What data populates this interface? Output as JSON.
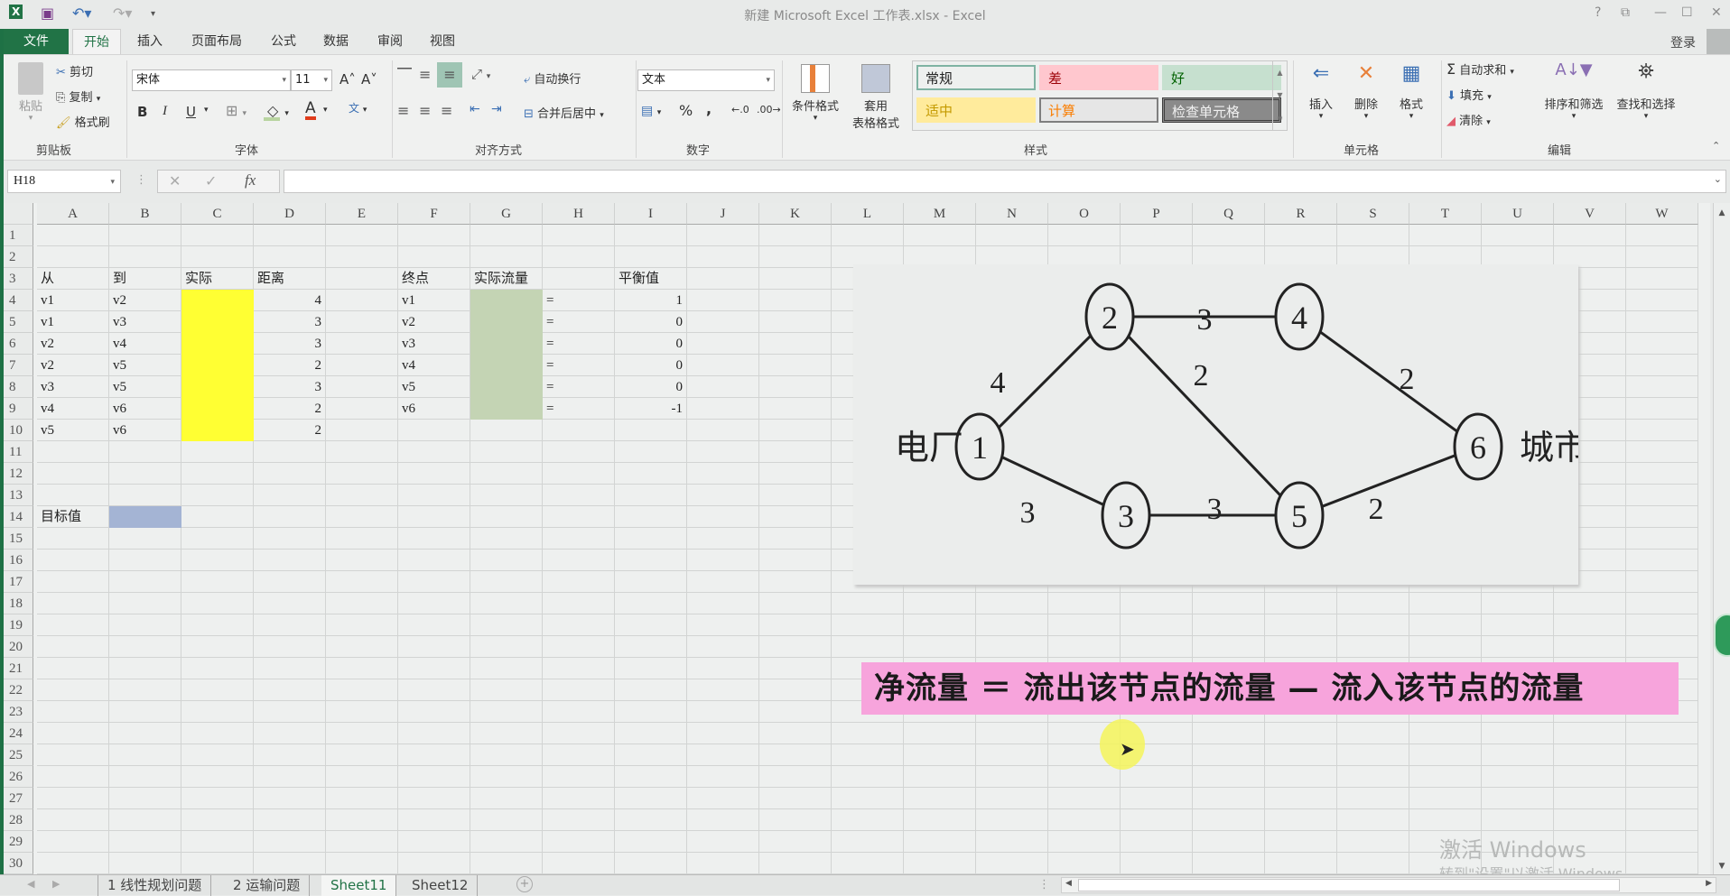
{
  "window": {
    "title": "新建 Microsoft Excel 工作表.xlsx - Excel",
    "controls": [
      "?",
      "⧉",
      "—",
      "☐",
      "✕"
    ],
    "login": "登录"
  },
  "quick_access": {
    "excel_logo": "X",
    "save": "save",
    "undo": "undo",
    "redo": "redo"
  },
  "tabs": [
    {
      "label": "文件",
      "kind": "file"
    },
    {
      "label": "开始",
      "kind": "active"
    },
    {
      "label": "插入"
    },
    {
      "label": "页面布局"
    },
    {
      "label": "公式"
    },
    {
      "label": "数据"
    },
    {
      "label": "审阅"
    },
    {
      "label": "视图"
    }
  ],
  "ribbon": {
    "clipboard": {
      "paste": "粘贴",
      "cut": "剪切",
      "copy": "复制",
      "format_painter": "格式刷",
      "label": "剪贴板"
    },
    "font": {
      "name": "宋体",
      "size": "11",
      "bold": "B",
      "italic": "I",
      "underline": "U",
      "grow": "A",
      "shrink": "A",
      "label": "字体"
    },
    "alignment": {
      "wrap": "自动换行",
      "merge": "合并后居中",
      "label": "对齐方式"
    },
    "number": {
      "format": "文本",
      "percent": "%",
      "comma": ",",
      "label": "数字"
    },
    "styles": {
      "conditional": "条件格式",
      "table_format_line1": "套用",
      "table_format_line2": "表格格式",
      "cells": [
        {
          "label": "常规",
          "bg": "#eef0ef",
          "fg": "#222222",
          "border": "#7fb3a3"
        },
        {
          "label": "差",
          "bg": "#ffc7ce",
          "fg": "#9c0006",
          "border": "#ffc7ce"
        },
        {
          "label": "好",
          "bg": "#c6e0cf",
          "fg": "#006100",
          "border": "#c6e0cf"
        },
        {
          "label": "适中",
          "bg": "#ffeb9c",
          "fg": "#c49a00",
          "border": "#ffeb9c"
        },
        {
          "label": "计算",
          "bg": "#e6e6e6",
          "fg": "#fa7d00",
          "border": "#7f7f7f"
        },
        {
          "label": "检查单元格",
          "bg": "#8a8a8a",
          "fg": "#f0f0f0",
          "border": "#3f3f3f"
        }
      ],
      "label": "样式"
    },
    "cells": {
      "insert": "插入",
      "delete": "删除",
      "format": "格式",
      "label": "单元格"
    },
    "editing": {
      "autosum": "自动求和",
      "fill": "填充",
      "clear": "清除",
      "sort_filter": "排序和筛选",
      "find_select": "查找和选择",
      "label": "编辑"
    }
  },
  "formula_bar": {
    "name_box": "H18",
    "fx": "fx",
    "cancel": "✕",
    "confirm": "✓",
    "value": ""
  },
  "columns": [
    "A",
    "B",
    "C",
    "D",
    "E",
    "F",
    "G",
    "H",
    "I",
    "J",
    "K",
    "L",
    "M",
    "N",
    "O",
    "P",
    "Q",
    "R",
    "S",
    "T",
    "U",
    "V",
    "W"
  ],
  "rows": [
    "1",
    "2",
    "3",
    "4",
    "5",
    "6",
    "7",
    "8",
    "9",
    "10",
    "11",
    "12",
    "13",
    "14",
    "15",
    "16",
    "17",
    "18",
    "19",
    "20",
    "21",
    "22",
    "23",
    "24",
    "25",
    "26",
    "27",
    "28",
    "29",
    "30"
  ],
  "sheet": {
    "headers": {
      "from": "从",
      "to": "到",
      "actual": "实际",
      "distance": "距离",
      "node": "终点",
      "actual_flow": "实际流量",
      "balance": "平衡值"
    },
    "edges": [
      {
        "from": "v1",
        "to": "v2",
        "distance": "4"
      },
      {
        "from": "v1",
        "to": "v3",
        "distance": "3"
      },
      {
        "from": "v2",
        "to": "v4",
        "distance": "3"
      },
      {
        "from": "v2",
        "to": "v5",
        "distance": "2"
      },
      {
        "from": "v3",
        "to": "v5",
        "distance": "3"
      },
      {
        "from": "v4",
        "to": "v6",
        "distance": "2"
      },
      {
        "from": "v5",
        "to": "v6",
        "distance": "2"
      }
    ],
    "nodes": [
      {
        "node": "v1",
        "eq": "=",
        "balance": "1"
      },
      {
        "node": "v2",
        "eq": "=",
        "balance": "0"
      },
      {
        "node": "v3",
        "eq": "=",
        "balance": "0"
      },
      {
        "node": "v4",
        "eq": "=",
        "balance": "0"
      },
      {
        "node": "v5",
        "eq": "=",
        "balance": "0"
      },
      {
        "node": "v6",
        "eq": "=",
        "balance": "-1"
      }
    ],
    "objective_label": "目标值",
    "colors": {
      "actual_fill": "#ffff33",
      "flow_fill": "#c4d4b4",
      "objective_fill": "#a4b4d4"
    }
  },
  "graph": {
    "source_label": "电厂",
    "sink_label": "城市",
    "nodes": [
      "1",
      "2",
      "3",
      "4",
      "5",
      "6"
    ],
    "edges": [
      {
        "from": "1",
        "to": "2",
        "weight": "4"
      },
      {
        "from": "1",
        "to": "3",
        "weight": "3"
      },
      {
        "from": "2",
        "to": "4",
        "weight": "3"
      },
      {
        "from": "2",
        "to": "5",
        "weight": "2"
      },
      {
        "from": "3",
        "to": "5",
        "weight": "3"
      },
      {
        "from": "4",
        "to": "6",
        "weight": "2"
      },
      {
        "from": "5",
        "to": "6",
        "weight": "2"
      }
    ]
  },
  "banner": {
    "text": "净流量 ＝ 流出该节点的流量 — 流入该节点的流量",
    "bg": "#f7a4dc"
  },
  "watermark": {
    "line1": "激活 Windows",
    "line2": "转到\"设置\"以激活 Windows。"
  },
  "sheet_tabs": [
    {
      "label": "1 线性规划问题"
    },
    {
      "label": "2 运输问题"
    },
    {
      "label": "Sheet11",
      "active": true
    },
    {
      "label": "Sheet12"
    }
  ],
  "add_sheet": "+"
}
